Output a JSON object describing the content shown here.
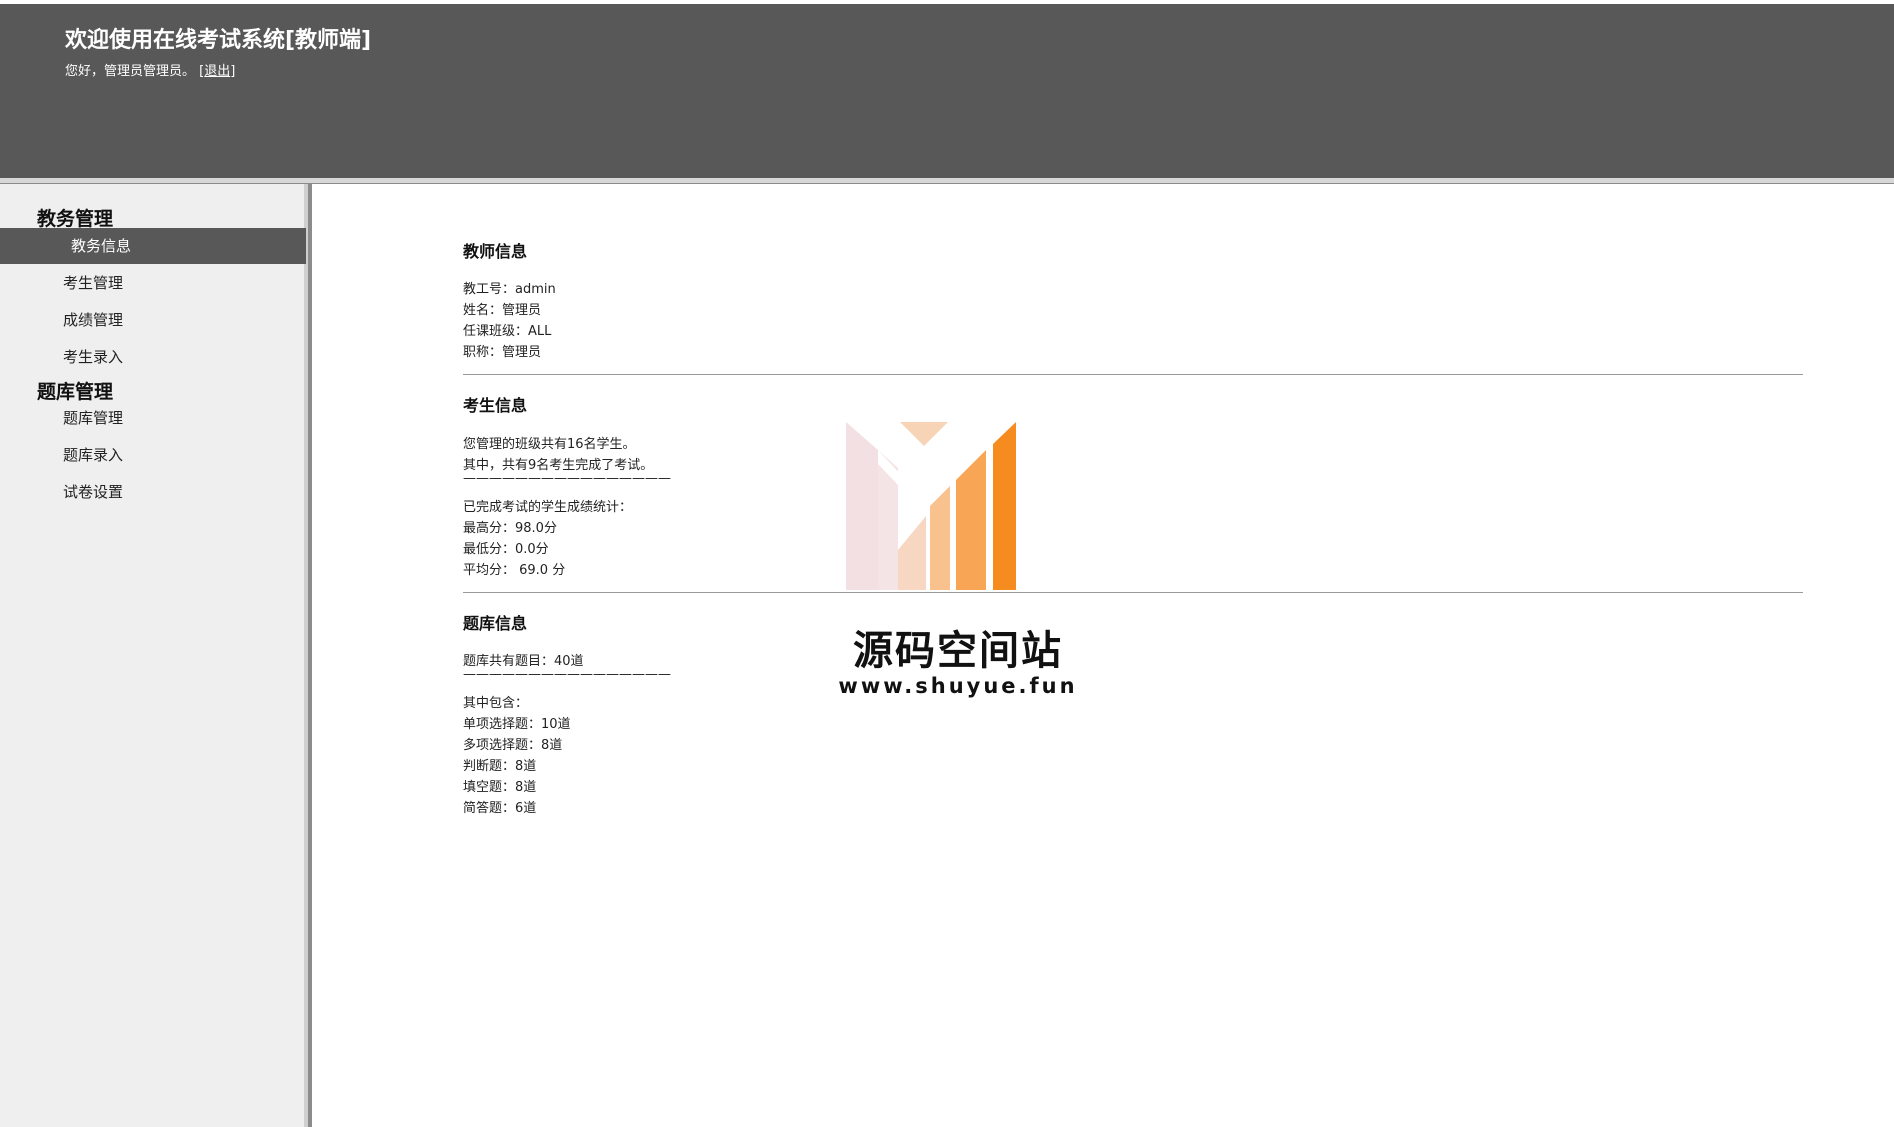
{
  "header": {
    "title": "欢迎使用在线考试系统[教师端]",
    "greeting": "您好，管理员管理员。",
    "logout_open": "[",
    "logout_label": "退出",
    "logout_close": "]"
  },
  "sidebar": {
    "groups": [
      {
        "title": "教务管理",
        "items": [
          {
            "label": "教务信息",
            "active": true
          },
          {
            "label": "考生管理"
          },
          {
            "label": "成绩管理"
          },
          {
            "label": "考生录入"
          }
        ]
      },
      {
        "title": "题库管理",
        "items": [
          {
            "label": "题库管理"
          },
          {
            "label": "题库录入"
          },
          {
            "label": "试卷设置"
          }
        ]
      }
    ]
  },
  "main": {
    "teacher": {
      "title": "教师信息",
      "lines": [
        "教工号：admin",
        "姓名：管理员",
        "任课班级：ALL",
        "职称：管理员"
      ]
    },
    "students": {
      "title": "考生信息",
      "lines": [
        "您管理的班级共有16名学生。",
        "其中，共有9名考生完成了考试。",
        "————————————————",
        "已完成考试的学生成绩统计：",
        "最高分：98.0分",
        "最低分：0.0分",
        "平均分： 69.0 分"
      ]
    },
    "bank": {
      "title": "题库信息",
      "lines": [
        "题库共有题目：40道",
        "————————————————",
        "其中包含：",
        "单项选择题：10道",
        "多项选择题：8道",
        "判断题：8道",
        "填空题：8道",
        "简答题：6道"
      ]
    }
  },
  "watermark": {
    "text": "源码空间站",
    "url": "www.shuyue.fun"
  },
  "colors": {
    "header_bg": "#585858",
    "sidebar_bg": "#efefef",
    "active_item_bg": "#585858",
    "logo_orange": "#f68b1f",
    "logo_pink": "#f2dfe1"
  }
}
